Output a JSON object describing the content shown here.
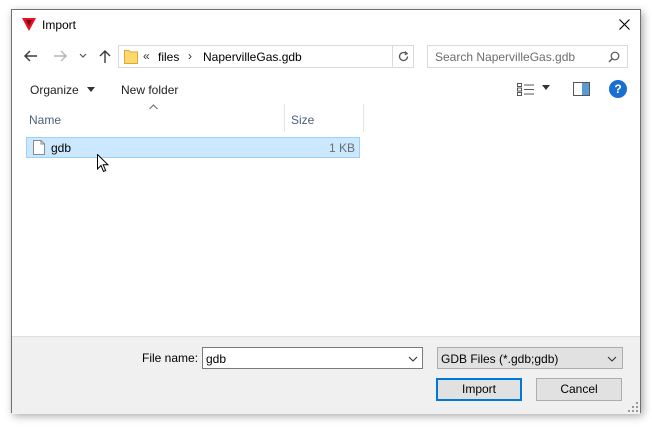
{
  "window": {
    "title": "Import",
    "close_glyph": "✕"
  },
  "nav": {
    "back_icon": "arrow-left-icon",
    "forward_icon": "arrow-right-icon",
    "recent_icon": "chevron-down-icon",
    "up_icon": "arrow-up-icon"
  },
  "address": {
    "overflow": "«",
    "crumbs": [
      "files",
      "NapervilleGas.gdb"
    ],
    "separator": "›"
  },
  "search": {
    "placeholder": "Search NapervilleGas.gdb"
  },
  "toolbar": {
    "organize_label": "Organize",
    "new_folder_label": "New folder"
  },
  "filelist": {
    "columns": [
      {
        "label": "Name"
      },
      {
        "label": "Size"
      }
    ],
    "rows": [
      {
        "name": "gdb",
        "size": "1 KB",
        "selected": true
      }
    ]
  },
  "footer": {
    "file_name_label": "File name:",
    "file_name_value": "gdb",
    "filter_value": "GDB Files (*.gdb;gdb)",
    "import_label": "Import",
    "cancel_label": "Cancel"
  },
  "colors": {
    "accent": "#0078d7",
    "selection": "#cce8ff",
    "selection_border": "#99d1ff",
    "help": "#1a6fd0",
    "app_icon": "#e81123"
  }
}
